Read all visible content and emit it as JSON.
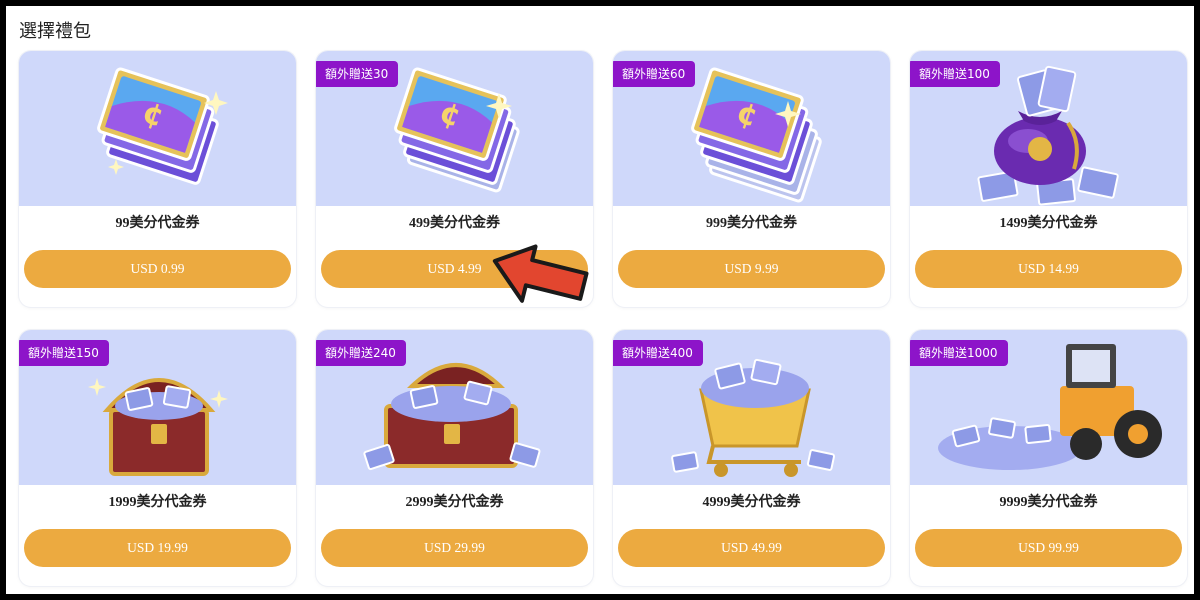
{
  "page": {
    "title": "選擇禮包"
  },
  "packages": [
    {
      "name": "99美分代金券",
      "price": "USD 0.99",
      "bonus": "",
      "art": "coupon-stack-icon"
    },
    {
      "name": "499美分代金券",
      "price": "USD 4.99",
      "bonus": "額外贈送30",
      "art": "coupon-stack-icon"
    },
    {
      "name": "999美分代金券",
      "price": "USD 9.99",
      "bonus": "額外贈送60",
      "art": "coupon-pile-icon"
    },
    {
      "name": "1499美分代金券",
      "price": "USD 14.99",
      "bonus": "額外贈送100",
      "art": "coupon-bag-icon"
    },
    {
      "name": "1999美分代金券",
      "price": "USD 19.99",
      "bonus": "額外贈送150",
      "art": "treasure-chest-icon"
    },
    {
      "name": "2999美分代金券",
      "price": "USD 29.99",
      "bonus": "額外贈送240",
      "art": "treasure-chest-large-icon"
    },
    {
      "name": "4999美分代金券",
      "price": "USD 49.99",
      "bonus": "額外贈送400",
      "art": "coupon-cart-icon"
    },
    {
      "name": "9999美分代金券",
      "price": "USD 99.99",
      "bonus": "額外贈送1000",
      "art": "coupon-loader-icon"
    }
  ],
  "colors": {
    "card_image_bg": "#cfd8fa",
    "badge": "#8d14c9",
    "button": "#ecaa40",
    "pointer": "#e2462f"
  }
}
